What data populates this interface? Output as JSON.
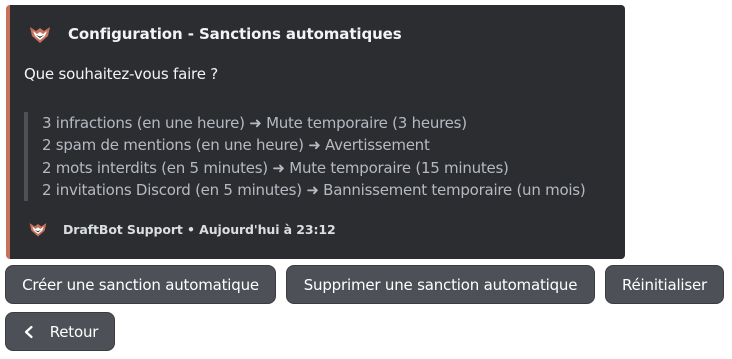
{
  "embed": {
    "accent_color": "#c7715a",
    "author": {
      "icon": "draftbot-logo-icon",
      "title": "Configuration - Sanctions automatiques"
    },
    "description": "Que souhaitez-vous faire ?",
    "rules": [
      "3 infractions (en une heure) ➜ Mute temporaire (3 heures)",
      "2 spam de mentions (en une heure) ➜ Avertissement",
      "2 mots interdits (en 5 minutes) ➜ Mute temporaire (15 minutes)",
      "2 invitations Discord (en 5 minutes) ➜ Bannissement temporaire (un mois)"
    ],
    "footer": {
      "icon": "draftbot-logo-icon",
      "text": "DraftBot Support • Aujourd'hui à 23:12"
    }
  },
  "buttons": {
    "create": "Créer une sanction automatique",
    "delete": "Supprimer une sanction automatique",
    "reset": "Réinitialiser",
    "back": "Retour",
    "back_icon": "chevron-left-icon"
  }
}
